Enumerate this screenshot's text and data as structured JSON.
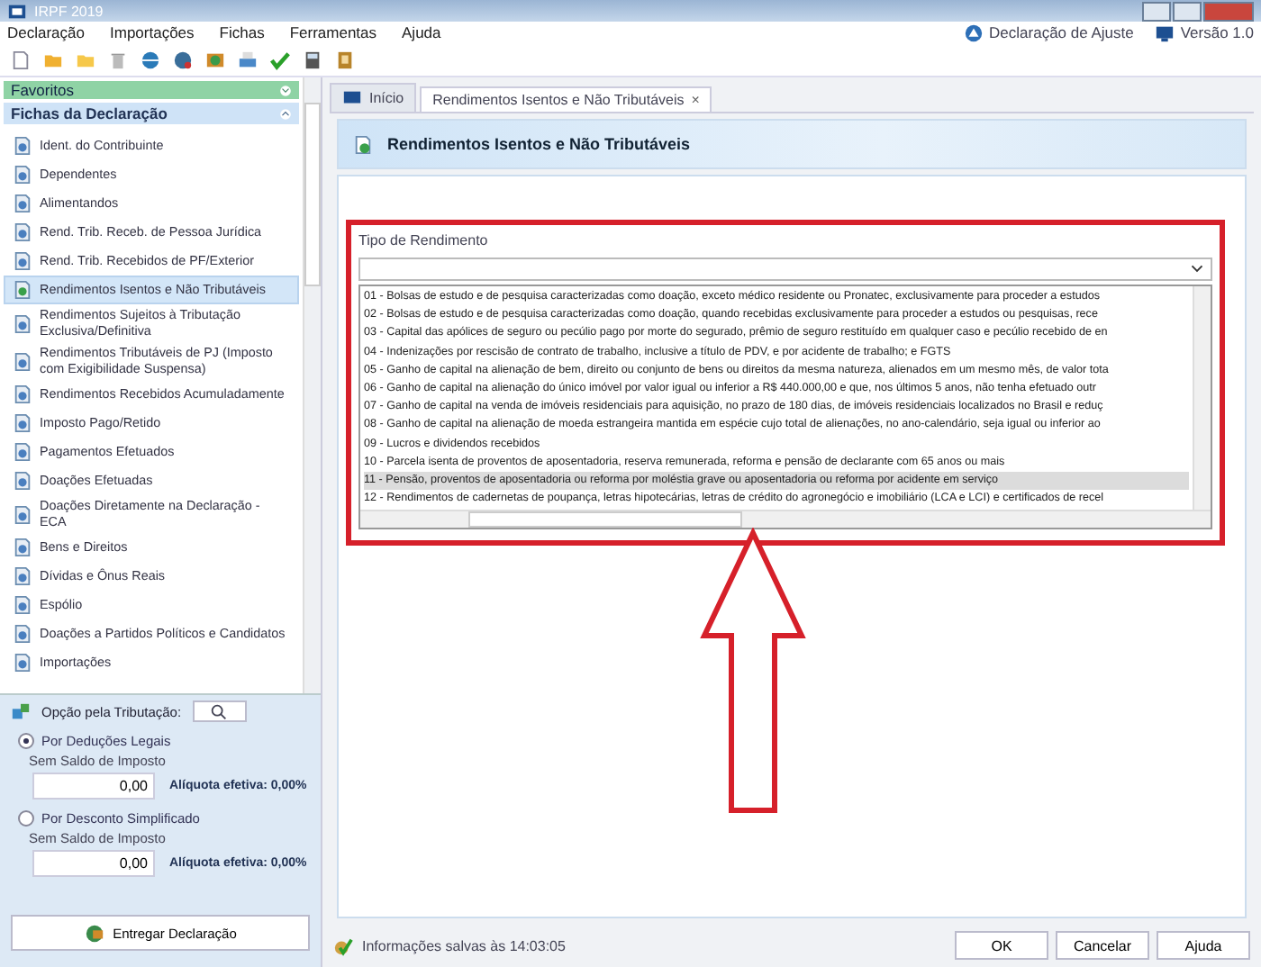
{
  "window": {
    "title": "IRPF 2019"
  },
  "menu": [
    "Declaração",
    "Importações",
    "Fichas",
    "Ferramentas",
    "Ajuda"
  ],
  "top_links": [
    "Declaração de Ajuste",
    "Versão 1.0"
  ],
  "sidebar": {
    "favorites": "Favoritos",
    "section": "Fichas da Declaração",
    "items": [
      {
        "label": "Ident. do Contribuinte",
        "selected": false
      },
      {
        "label": "Dependentes",
        "selected": false
      },
      {
        "label": "Alimentandos",
        "selected": false
      },
      {
        "label": "Rend. Trib. Receb. de Pessoa Jurídica",
        "selected": false
      },
      {
        "label": "Rend. Trib. Recebidos de PF/Exterior",
        "selected": false
      },
      {
        "label": "Rendimentos Isentos e Não Tributáveis",
        "selected": true
      },
      {
        "label": "Rendimentos Sujeitos à Tributação Exclusiva/Definitiva",
        "selected": false
      },
      {
        "label": "Rendimentos Tributáveis de PJ (Imposto com Exigibilidade Suspensa)",
        "selected": false
      },
      {
        "label": "Rendimentos Recebidos Acumuladamente",
        "selected": false
      },
      {
        "label": "Imposto Pago/Retido",
        "selected": false
      },
      {
        "label": "Pagamentos Efetuados",
        "selected": false
      },
      {
        "label": "Doações Efetuadas",
        "selected": false
      },
      {
        "label": "Doações Diretamente na Declaração - ECA",
        "selected": false
      },
      {
        "label": "Bens e Direitos",
        "selected": false
      },
      {
        "label": "Dívidas e Ônus Reais",
        "selected": false
      },
      {
        "label": "Espólio",
        "selected": false
      },
      {
        "label": "Doações a Partidos Políticos e Candidatos",
        "selected": false
      },
      {
        "label": "Importações",
        "selected": false
      }
    ]
  },
  "taxation": {
    "title": "Opção pela Tributação:",
    "options": [
      {
        "label": "Por Deduções Legais",
        "selected": true,
        "status": "Sem Saldo de Imposto",
        "value": "0,00",
        "rate": "Alíquota efetiva: 0,00%"
      },
      {
        "label": "Por Desconto Simplificado",
        "selected": false,
        "status": "Sem Saldo de Imposto",
        "value": "0,00",
        "rate": "Alíquota efetiva: 0,00%"
      }
    ],
    "submit": "Entregar Declaração"
  },
  "tabs": [
    {
      "label": "Início",
      "selected": false
    },
    {
      "label": "Rendimentos Isentos e Não Tributáveis",
      "selected": true,
      "close": "×"
    }
  ],
  "form": {
    "title": "Rendimentos Isentos e Não Tributáveis",
    "field_label": "Tipo de Rendimento",
    "options": [
      {
        "label": "01 - Bolsas de estudo e de pesquisa caracterizadas como doação, exceto médico residente ou Pronatec, exclusivamente para proceder a estudos",
        "selected": false
      },
      {
        "label": "02 - Bolsas de estudo e de pesquisa caracterizadas como doação, quando recebidas exclusivamente para proceder a estudos ou pesquisas, rece",
        "selected": false
      },
      {
        "label": "03 - Capital das apólices de seguro ou pecúlio pago por morte do segurado, prêmio de seguro restituído em qualquer caso e pecúlio recebido de en",
        "selected": false
      },
      {
        "label": "04 - Indenizações por rescisão de contrato de trabalho, inclusive a título de PDV, e por acidente de trabalho; e FGTS",
        "selected": false
      },
      {
        "label": "05 - Ganho de capital na alienação de bem, direito ou conjunto de bens ou direitos da mesma natureza, alienados em um mesmo mês, de valor tota",
        "selected": false
      },
      {
        "label": "06 - Ganho de capital na alienação do único imóvel por valor igual ou inferior a R$ 440.000,00 e que, nos últimos 5 anos, não tenha efetuado outr",
        "selected": false
      },
      {
        "label": "07 - Ganho de capital na venda de imóveis residenciais para aquisição, no prazo de 180 dias, de imóveis residenciais localizados no Brasil e reduç",
        "selected": false
      },
      {
        "label": "08 - Ganho de capital na alienação de moeda estrangeira mantida em espécie cujo total de alienações, no ano-calendário, seja igual ou inferior ao",
        "selected": false
      },
      {
        "label": "09 - Lucros e dividendos recebidos",
        "selected": false
      },
      {
        "label": "10 - Parcela isenta de proventos de aposentadoria, reserva remunerada, reforma e pensão de declarante com 65 anos ou mais",
        "selected": false
      },
      {
        "label": "11 - Pensão, proventos de aposentadoria ou reforma por moléstia grave ou aposentadoria ou reforma por acidente em serviço",
        "selected": true
      },
      {
        "label": "12 - Rendimentos de cadernetas de poupança, letras hipotecárias, letras de crédito do agronegócio e imobiliário (LCA e LCI) e certificados de recel",
        "selected": false
      }
    ]
  },
  "status_bar": {
    "text": "Informações salvas às 14:03:05",
    "buttons": [
      "OK",
      "Cancelar",
      "Ajuda"
    ]
  }
}
